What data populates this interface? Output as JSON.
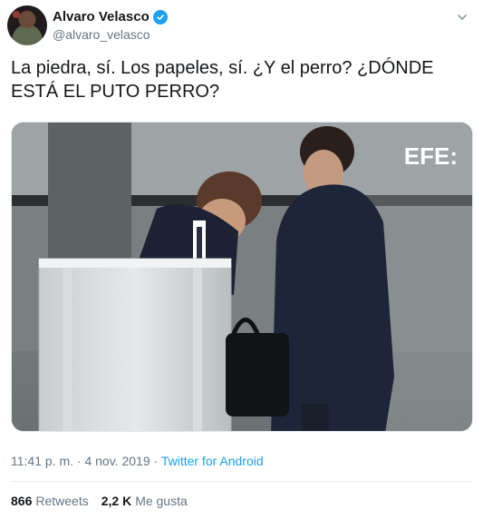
{
  "author": {
    "display_name": "Alvaro Velasco",
    "handle": "@alvaro_velasco",
    "verified": true
  },
  "tweet": {
    "text_line1": "La piedra, sí. Los papeles, sí. ¿Y el perro? ¿DÓNDE",
    "text_line2": "ESTÁ EL PUTO PERRO?"
  },
  "media": {
    "watermark": "EFE:",
    "description": ""
  },
  "meta": {
    "time": "11:41 p. m.",
    "separator": "·",
    "date": "4 nov. 2019",
    "source": "Twitter for Android"
  },
  "stats": {
    "retweets_count": "866",
    "retweets_label": "Retweets",
    "likes_count": "2,2 K",
    "likes_label": "Me gusta"
  },
  "colors": {
    "accent": "#1da1f2",
    "text": "#14171a",
    "secondary": "#657786"
  },
  "icons": [
    "verified-badge-icon",
    "chevron-down-icon"
  ]
}
